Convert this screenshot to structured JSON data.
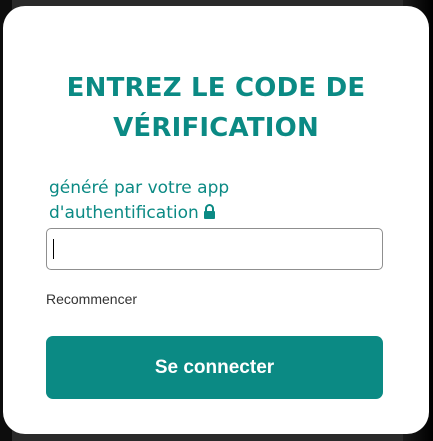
{
  "form": {
    "title_line1": "ENTREZ LE CODE DE",
    "title_line2": "VÉRIFICATION",
    "subtitle_line1": "généré par votre app",
    "subtitle_line2": "d'authentification",
    "code_value": "",
    "code_placeholder": "",
    "restart_label": "Recommencer",
    "submit_label": "Se connecter"
  },
  "icons": {
    "lock": "lock-icon"
  },
  "colors": {
    "accent": "#0b8a84",
    "card": "#ffffff",
    "link": "#333333"
  }
}
